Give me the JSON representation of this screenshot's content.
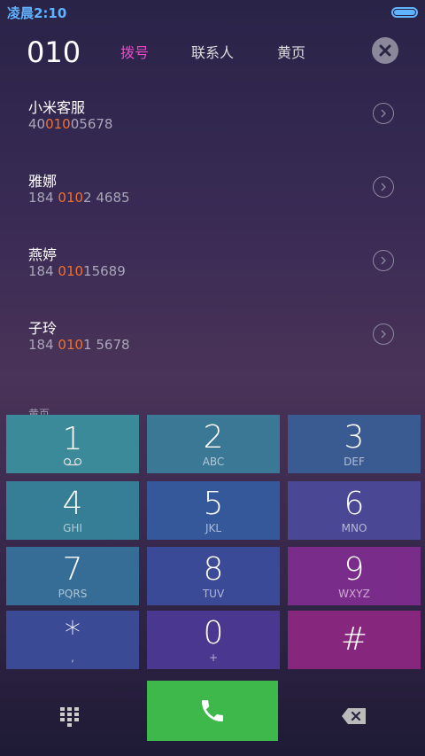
{
  "status": {
    "time": "凌晨2:10"
  },
  "header": {
    "dialed": "010",
    "tabs": [
      {
        "label": "拨号",
        "active": true
      },
      {
        "label": "联系人",
        "active": false
      },
      {
        "label": "黄页",
        "active": false
      }
    ]
  },
  "results": [
    {
      "name": "小米客服",
      "num_pre": "40",
      "num_hl": "010",
      "num_post": "05678"
    },
    {
      "name": "雅娜",
      "num_pre": "184 ",
      "num_hl": "010",
      "num_post": "2 4685"
    },
    {
      "name": "燕婷",
      "num_pre": "184 ",
      "num_hl": "010",
      "num_post": "15689"
    },
    {
      "name": "子玲",
      "num_pre": "184 ",
      "num_hl": "010",
      "num_post": "1 5678"
    }
  ],
  "section_label": "黄页",
  "keypad": [
    {
      "digit": "1",
      "letters": "",
      "color": "#3a8a9a"
    },
    {
      "digit": "2",
      "letters": "ABC",
      "color": "#3a7896"
    },
    {
      "digit": "3",
      "letters": "DEF",
      "color": "#3a5a92"
    },
    {
      "digit": "4",
      "letters": "GHI",
      "color": "#357e96"
    },
    {
      "digit": "5",
      "letters": "JKL",
      "color": "#34589a"
    },
    {
      "digit": "6",
      "letters": "MNO",
      "color": "#4a4894"
    },
    {
      "digit": "7",
      "letters": "PQRS",
      "color": "#366d96"
    },
    {
      "digit": "8",
      "letters": "TUV",
      "color": "#3b4a96"
    },
    {
      "digit": "9",
      "letters": "WXYZ",
      "color": "#7a2c8a"
    },
    {
      "digit": "*",
      "letters": ",",
      "color": "#3a4a94"
    },
    {
      "digit": "0",
      "letters": "+",
      "color": "#4a3890"
    },
    {
      "digit": "#",
      "letters": "",
      "color": "#86267c"
    }
  ],
  "colors": {
    "accent": "#e64cc8",
    "highlight": "#f07030",
    "call": "#3fb84b"
  },
  "icons": {
    "voicemail": "voicemail-icon",
    "close": "close-icon",
    "call": "phone-icon",
    "backspace": "backspace-icon",
    "dialpad": "dialpad-icon"
  }
}
